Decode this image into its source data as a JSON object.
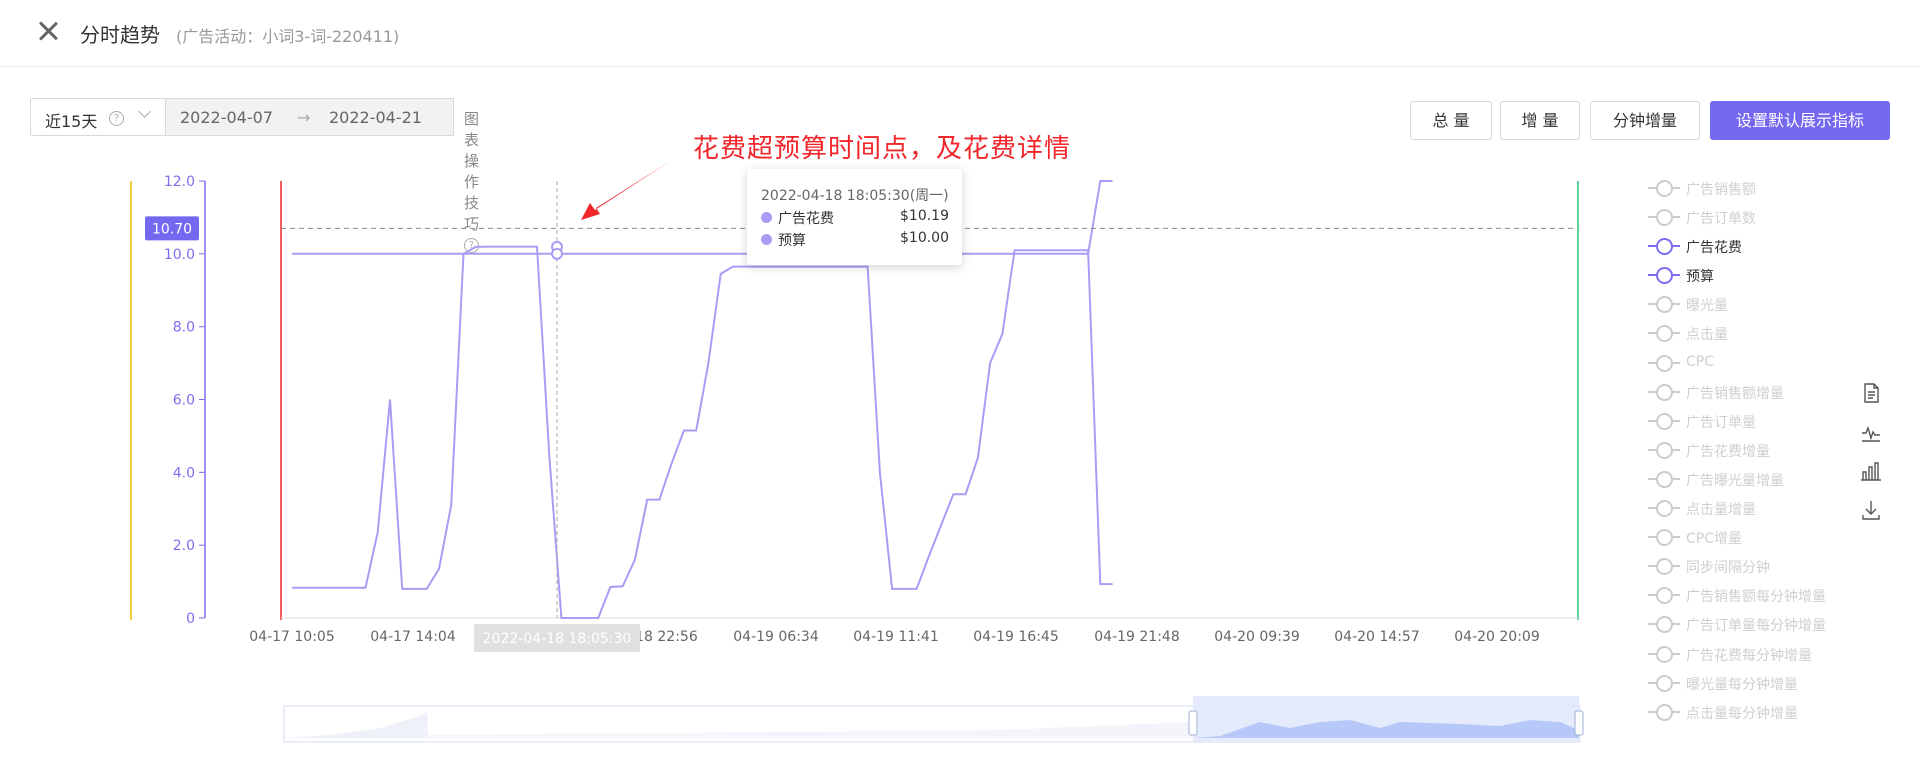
{
  "header": {
    "title": "分时趋势",
    "subtitle": "(广告活动：小词3-词-220411)"
  },
  "toolbar": {
    "range_label": "近15天",
    "range_help": "?",
    "start_date": "2022-04-07",
    "arrow": "→",
    "end_date": "2022-04-21",
    "tips_label": "图表操作技巧",
    "tips_help": "?"
  },
  "buttons": {
    "total": "总 量",
    "increment": "增 量",
    "minute_increment": "分钟增量",
    "set_default": "设置默认展示指标"
  },
  "annotation": "花费超预算时间点，及花费详情",
  "tooltip": {
    "title": "2022-04-18 18:05:30(周一)",
    "rows": [
      {
        "name": "广告花费",
        "value": "$10.19",
        "color": "#a99cf5"
      },
      {
        "name": "预算",
        "value": "$10.00",
        "color": "#a99cf5"
      }
    ]
  },
  "legend": [
    {
      "label": "广告销售额",
      "active": false
    },
    {
      "label": "广告订单数",
      "active": false
    },
    {
      "label": "广告花费",
      "active": true
    },
    {
      "label": "预算",
      "active": true
    },
    {
      "label": "曝光量",
      "active": false
    },
    {
      "label": "点击量",
      "active": false
    },
    {
      "label": "CPC",
      "active": false
    },
    {
      "label": "广告销售额增量",
      "active": false
    },
    {
      "label": "广告订单量",
      "active": false
    },
    {
      "label": "广告花费增量",
      "active": false
    },
    {
      "label": "广告曝光量增量",
      "active": false
    },
    {
      "label": "点击量增量",
      "active": false
    },
    {
      "label": "CPC增量",
      "active": false
    },
    {
      "label": "同步间隔分钟",
      "active": false
    },
    {
      "label": "广告销售额每分钟增量",
      "active": false
    },
    {
      "label": "广告订单量每分钟增量",
      "active": false
    },
    {
      "label": "广告花费每分钟增量",
      "active": false
    },
    {
      "label": "曝光量每分钟增量",
      "active": false
    },
    {
      "label": "点击量每分钟增量",
      "active": false
    }
  ],
  "tools": [
    "data-view-icon",
    "line-chart-icon",
    "bar-chart-icon",
    "download-icon"
  ],
  "colors": {
    "accent": "#7468f0",
    "series": "#a99cf5",
    "axis": "#7b6ff0",
    "annotation": "#f0262b"
  },
  "chart_data": {
    "type": "line",
    "ylim": [
      0,
      12
    ],
    "y_ticks": [
      "0",
      "2.0",
      "4.0",
      "6.0",
      "8.0",
      "10.0",
      "12.0"
    ],
    "x_tick_labels": [
      "04-17 10:05",
      "04-17 14:04",
      "2022-04-18 18:05:30",
      "04-18 22:56",
      "04-19 06:34",
      "04-19 11:41",
      "04-19 16:45",
      "04-19 21:48",
      "04-20 09:39",
      "04-20 14:57",
      "04-20 20:09"
    ],
    "axis_pointer_label": "2022-04-18 18:05:30",
    "y_pointer_label": "10.70",
    "x_range": [
      0,
      105
    ],
    "series": [
      {
        "name": "广告花费",
        "points": [
          [
            0,
            0.83
          ],
          [
            5,
            0.83
          ],
          [
            6,
            0.83
          ],
          [
            7,
            2.35
          ],
          [
            8,
            6.0
          ],
          [
            9,
            0.8
          ],
          [
            10,
            0.8
          ],
          [
            11,
            0.8
          ],
          [
            12,
            1.35
          ],
          [
            13,
            3.1
          ],
          [
            14,
            10.0
          ],
          [
            15,
            10.19
          ],
          [
            16,
            10.2
          ],
          [
            17,
            10.2
          ],
          [
            18,
            10.2
          ],
          [
            19,
            10.2
          ],
          [
            20,
            10.2
          ],
          [
            21,
            4.5
          ],
          [
            22,
            0
          ],
          [
            23,
            0
          ],
          [
            24,
            0
          ],
          [
            25,
            0
          ],
          [
            26,
            0.85
          ],
          [
            27,
            0.87
          ],
          [
            28,
            1.6
          ],
          [
            29,
            3.25
          ],
          [
            30,
            3.25
          ],
          [
            31,
            4.25
          ],
          [
            32,
            5.15
          ],
          [
            33,
            5.15
          ],
          [
            34,
            7.0
          ],
          [
            35,
            9.45
          ],
          [
            36,
            9.65
          ],
          [
            37,
            9.65
          ],
          [
            45,
            9.65
          ],
          [
            46,
            9.65
          ],
          [
            47,
            9.65
          ],
          [
            48,
            4.0
          ],
          [
            49,
            0.8
          ],
          [
            50,
            0.8
          ],
          [
            51,
            0.8
          ],
          [
            52,
            1.7
          ],
          [
            53,
            2.55
          ],
          [
            54,
            3.4
          ],
          [
            55,
            3.4
          ],
          [
            56,
            4.4
          ],
          [
            57,
            7.0
          ],
          [
            58,
            7.8
          ],
          [
            59,
            10.1
          ],
          [
            60,
            10.1
          ],
          [
            61,
            10.1
          ],
          [
            62,
            10.1
          ],
          [
            63,
            10.1
          ],
          [
            64,
            10.1
          ],
          [
            65,
            10.1
          ],
          [
            66,
            0.93
          ],
          [
            67,
            0.93
          ]
        ]
      },
      {
        "name": "预算",
        "points": [
          [
            0,
            10.0
          ],
          [
            64,
            10.0
          ],
          [
            65,
            10.0
          ],
          [
            66,
            12.0
          ],
          [
            67,
            12.0
          ]
        ]
      }
    ],
    "dashed_reference_y": 10.7
  }
}
